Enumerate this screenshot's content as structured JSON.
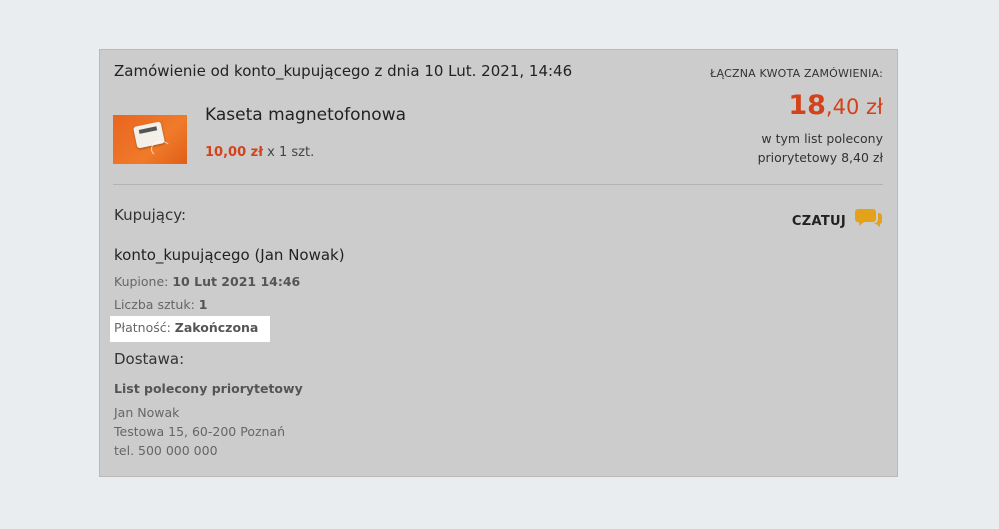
{
  "order": {
    "title": "Zamówienie od konto_kupującego z dnia 10 Lut. 2021, 14:46",
    "total_label": "ŁĄCZNA KWOTA ZAMÓWIENIA:",
    "total_int": "18",
    "total_rest": ",40 zł",
    "total_note_line1": "w tym list polecony",
    "total_note_line2": "priorytetowy 8,40 zł"
  },
  "product": {
    "name": "Kaseta magnetofonowa",
    "price": "10,00 zł",
    "qty": " x 1 szt.",
    "thumbnail_icon": "cassette-product-image"
  },
  "buyer": {
    "heading": "Kupujący:",
    "chat_label": "CZATUJ",
    "chat_icon": "chat-bubbles-icon",
    "name": "konto_kupującego (Jan Nowak)",
    "bought_label": "Kupione: ",
    "bought_value": "10 Lut 2021 14:46",
    "count_label": "Liczba sztuk: ",
    "count_value": "1",
    "payment_label": "Płatność: ",
    "payment_value": "Zakończona"
  },
  "shipping": {
    "heading": "Dostawa:",
    "method": "List polecony priorytetowy",
    "address_name": "Jan Nowak",
    "address_street": "Testowa 15, 60-200 Poznań",
    "phone": "tel. 500 000 000"
  },
  "colors": {
    "accent": "#d4421a",
    "chat_icon": "#e3a21a",
    "card_bg": "#cccccc",
    "page_bg": "#e9edf0",
    "highlight": "#ffffff"
  }
}
